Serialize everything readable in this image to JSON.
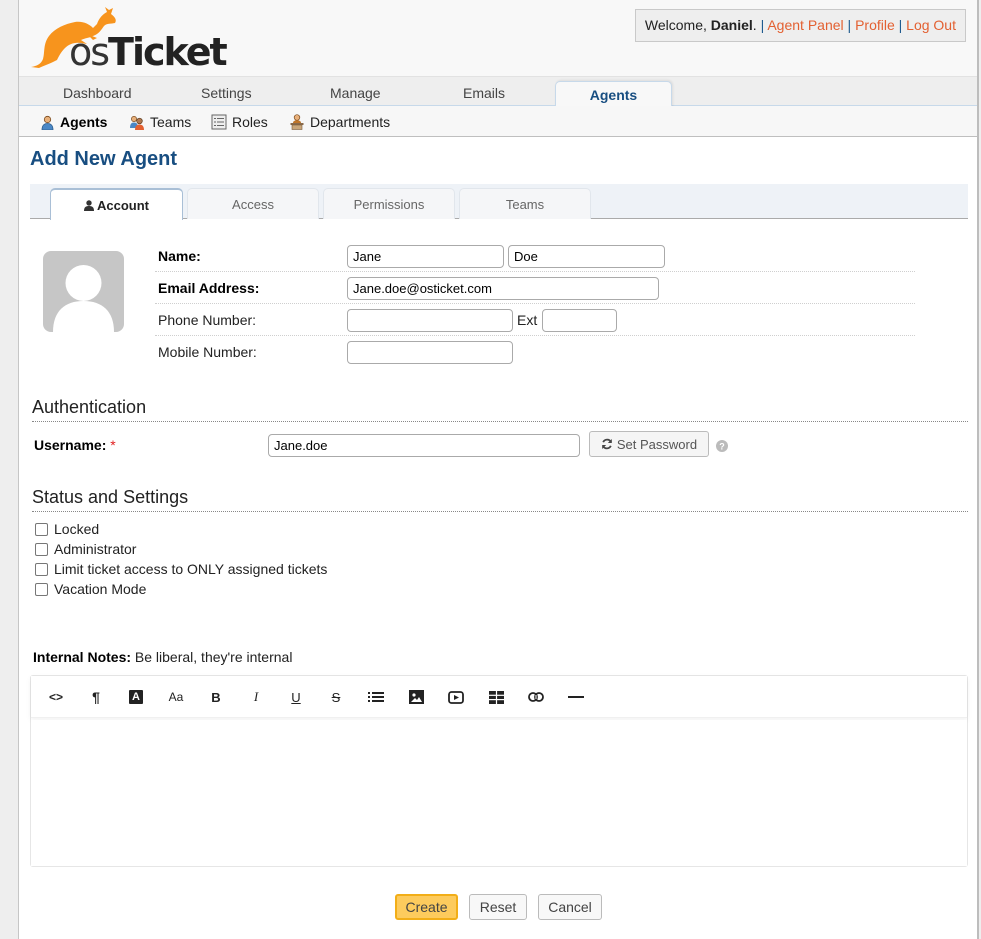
{
  "header": {
    "logo_text_prefix": "os",
    "logo_text_suffix": "Ticket",
    "logo_color": "#f7941d",
    "welcome_prefix": "Welcome, ",
    "user_name": "Daniel",
    "welcome_suffix": ".",
    "separator": "|",
    "links": [
      "Agent Panel",
      "Profile",
      "Log Out"
    ],
    "link_color": "#e36031"
  },
  "nav": {
    "tabs": [
      "Dashboard",
      "Settings",
      "Manage",
      "Emails",
      "Agents"
    ],
    "active": "Agents"
  },
  "subnav": {
    "items": [
      {
        "label": "Agents",
        "icon": "agent-icon",
        "active": true
      },
      {
        "label": "Teams",
        "icon": "teams-icon",
        "active": false
      },
      {
        "label": "Roles",
        "icon": "roles-icon",
        "active": false
      },
      {
        "label": "Departments",
        "icon": "departments-icon",
        "active": false
      }
    ]
  },
  "page": {
    "title": "Add New Agent",
    "title_color": "#184e81"
  },
  "form_tabs": [
    {
      "label": "Account",
      "icon": "user-icon",
      "active": true
    },
    {
      "label": "Access",
      "active": false
    },
    {
      "label": "Permissions",
      "active": false
    },
    {
      "label": "Teams",
      "active": false
    }
  ],
  "account": {
    "name_label": "Name:",
    "first_name": "Jane",
    "last_name": "Doe",
    "email_label": "Email Address:",
    "email": "Jane.doe@osticket.com",
    "phone_label": "Phone Number:",
    "phone": "",
    "ext_label": "Ext",
    "ext": "",
    "mobile_label": "Mobile Number:",
    "mobile": ""
  },
  "authentication": {
    "title": "Authentication",
    "username_label": "Username:",
    "required_mark": "*",
    "username": "Jane.doe",
    "set_password_label": "Set Password"
  },
  "status": {
    "title": "Status and Settings",
    "options": [
      {
        "label": "Locked",
        "checked": false
      },
      {
        "label": "Administrator",
        "checked": false
      },
      {
        "label": "Limit ticket access to ONLY assigned tickets",
        "checked": false
      },
      {
        "label": "Vacation Mode",
        "checked": false
      }
    ]
  },
  "notes": {
    "label": "Internal Notes:",
    "hint": "Be liberal, they're internal",
    "content": "",
    "toolbar": [
      {
        "name": "code-view",
        "glyph": "<>"
      },
      {
        "name": "paragraph-format",
        "glyph": "¶"
      },
      {
        "name": "text-color",
        "glyph": "A"
      },
      {
        "name": "font-size",
        "glyph": "Aa"
      },
      {
        "name": "bold",
        "glyph": "B"
      },
      {
        "name": "italic",
        "glyph": "I"
      },
      {
        "name": "underline",
        "glyph": "U"
      },
      {
        "name": "strikethrough",
        "glyph": "S"
      },
      {
        "name": "list",
        "glyph": "list"
      },
      {
        "name": "image",
        "glyph": "image"
      },
      {
        "name": "video",
        "glyph": "video"
      },
      {
        "name": "table",
        "glyph": "table"
      },
      {
        "name": "link",
        "glyph": "link"
      },
      {
        "name": "horizontal-line",
        "glyph": "—"
      }
    ]
  },
  "actions": {
    "create": "Create",
    "reset": "Reset",
    "cancel": "Cancel",
    "create_color": "#fdcb5d"
  }
}
